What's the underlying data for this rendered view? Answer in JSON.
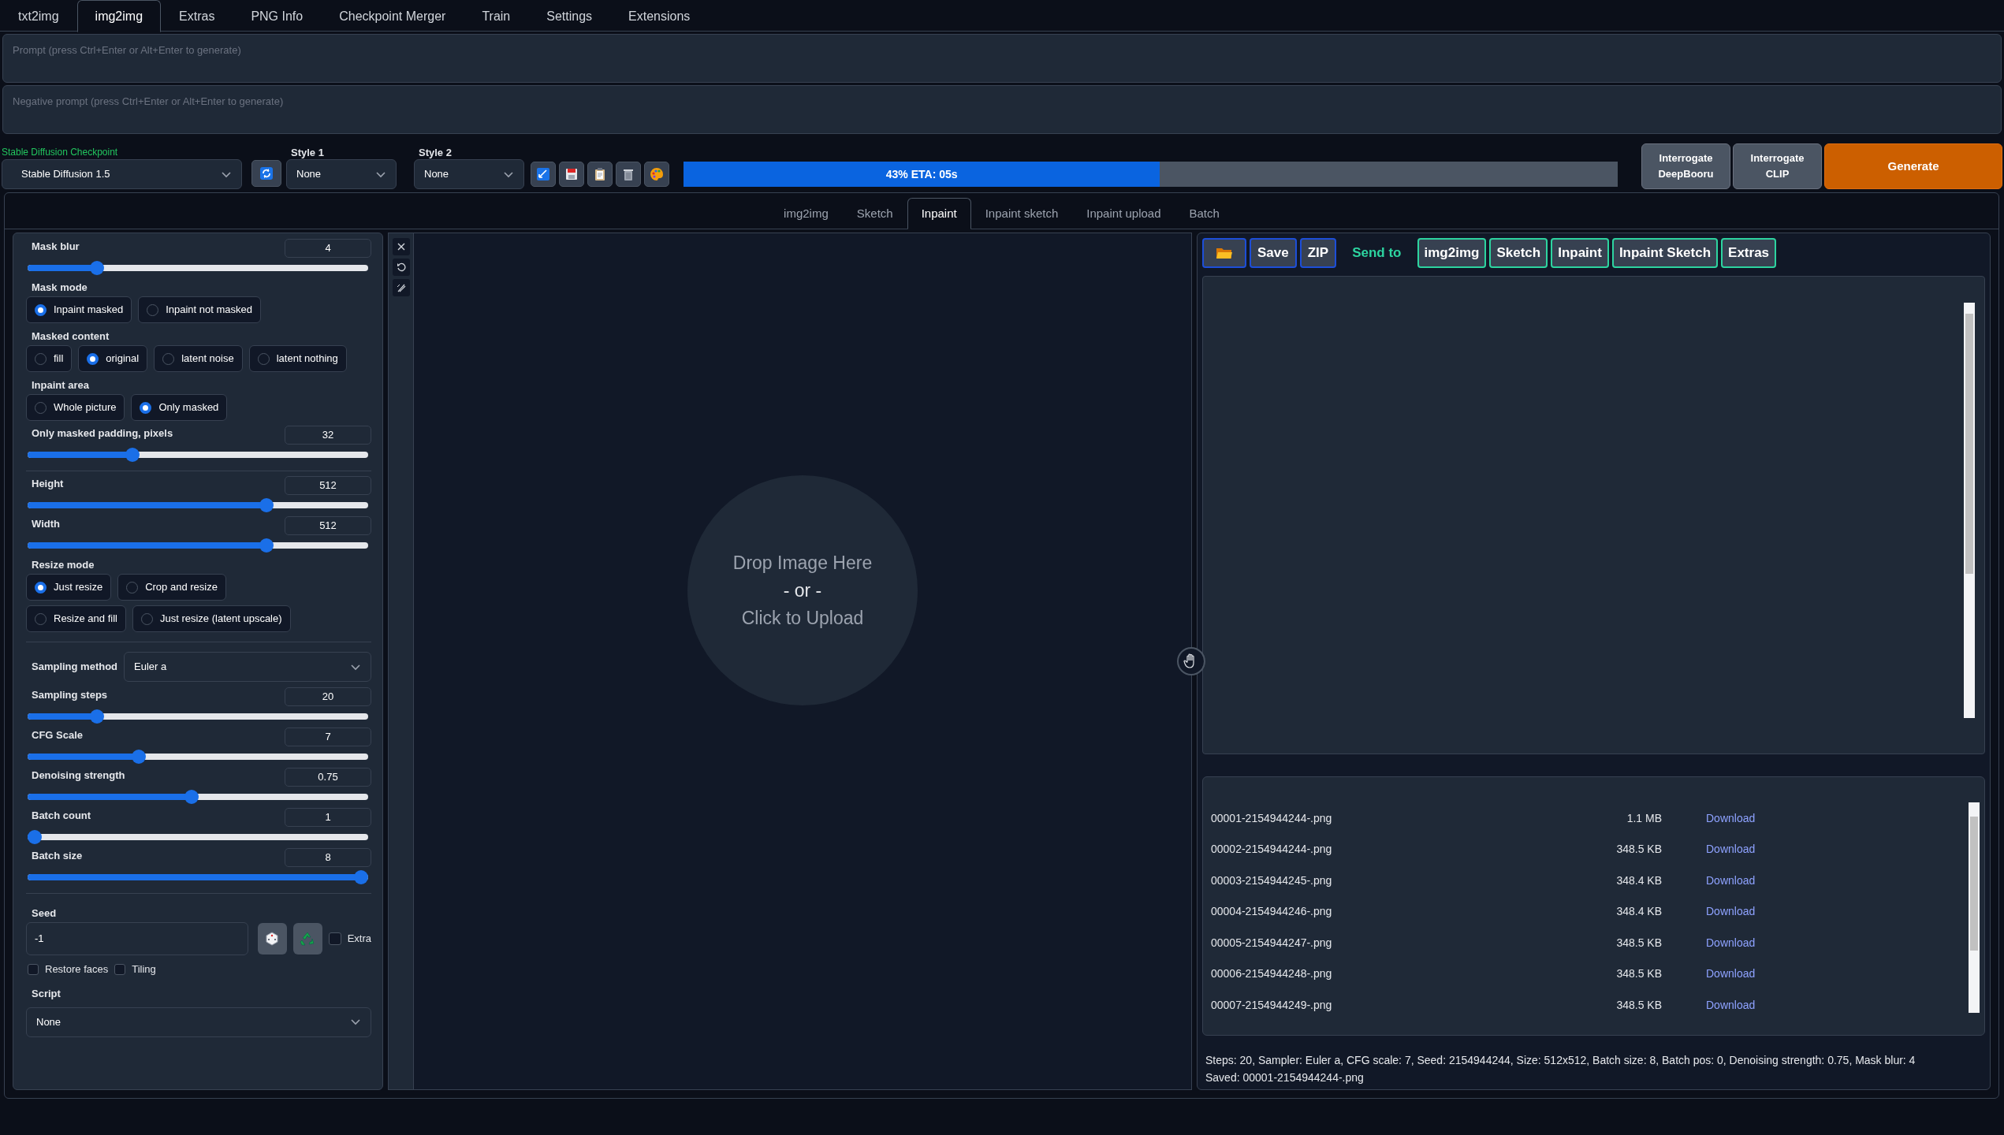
{
  "main_tabs": [
    {
      "label": "txt2img",
      "selected": false
    },
    {
      "label": "img2img",
      "selected": true
    },
    {
      "label": "Extras",
      "selected": false
    },
    {
      "label": "PNG Info",
      "selected": false
    },
    {
      "label": "Checkpoint Merger",
      "selected": false
    },
    {
      "label": "Train",
      "selected": false
    },
    {
      "label": "Settings",
      "selected": false
    },
    {
      "label": "Extensions",
      "selected": false
    }
  ],
  "prompt": {
    "placeholder": "Prompt (press Ctrl+Enter or Alt+Enter to generate)"
  },
  "negative_prompt": {
    "placeholder": "Negative prompt (press Ctrl+Enter or Alt+Enter to generate)"
  },
  "checkpoint": {
    "label": "Stable Diffusion Checkpoint",
    "value": "Stable Diffusion 1.5"
  },
  "styles": [
    {
      "label": "Style 1",
      "value": "None"
    },
    {
      "label": "Style 2",
      "value": "None"
    }
  ],
  "progress": {
    "level": 0.51,
    "text": "43% ETA: 05s"
  },
  "interrogate_buttons": [
    {
      "line1": "Interrogate",
      "line2": "DeepBooru"
    },
    {
      "line1": "Interrogate",
      "line2": "CLIP"
    }
  ],
  "generate_button": "Generate",
  "sub_tabs": [
    {
      "label": "img2img",
      "selected": false
    },
    {
      "label": "Sketch",
      "selected": false
    },
    {
      "label": "Inpaint",
      "selected": true
    },
    {
      "label": "Inpaint sketch",
      "selected": false
    },
    {
      "label": "Inpaint upload",
      "selected": false
    },
    {
      "label": "Batch",
      "selected": false
    }
  ],
  "settings_groups": [
    [
      {
        "kind": "slider",
        "label": "Mask blur",
        "value": "4",
        "level": 0.19
      },
      {
        "kind": "radio",
        "label": "Mask mode",
        "rows": [
          [
            {
              "label": "Inpaint masked",
              "selected": true
            },
            {
              "label": "Inpaint not masked",
              "selected": false
            }
          ]
        ]
      },
      {
        "kind": "radio",
        "label": "Masked content",
        "rows": [
          [
            {
              "label": "fill",
              "selected": false
            },
            {
              "label": "original",
              "selected": true
            },
            {
              "label": "latent noise",
              "selected": false
            },
            {
              "label": "latent nothing",
              "selected": false
            }
          ]
        ]
      },
      {
        "kind": "radio",
        "label": "Inpaint area",
        "rows": [
          [
            {
              "label": "Whole picture",
              "selected": false
            },
            {
              "label": "Only masked",
              "selected": true
            }
          ]
        ]
      },
      {
        "kind": "slider",
        "label": "Only masked padding, pixels",
        "value": "32",
        "level": 0.3
      }
    ],
    [
      {
        "kind": "slider",
        "label": "Height",
        "value": "512",
        "level": 0.71
      },
      {
        "kind": "slider",
        "label": "Width",
        "value": "512",
        "level": 0.71
      },
      {
        "kind": "radio",
        "label": "Resize mode",
        "rows": [
          [
            {
              "label": "Just resize",
              "selected": true
            },
            {
              "label": "Crop and resize",
              "selected": false
            }
          ],
          [
            {
              "label": "Resize and fill",
              "selected": false
            },
            {
              "label": "Just resize (latent upscale)",
              "selected": false
            }
          ]
        ]
      }
    ],
    [
      {
        "kind": "select_inline",
        "label": "Sampling method",
        "value": "Euler a"
      },
      {
        "kind": "slider",
        "label": "Sampling steps",
        "value": "20",
        "level": 0.19
      },
      {
        "kind": "slider",
        "label": "CFG Scale",
        "value": "7",
        "level": 0.32
      },
      {
        "kind": "slider",
        "label": "Denoising strength",
        "value": "0.75",
        "level": 0.48
      },
      {
        "kind": "slider",
        "label": "Batch count",
        "value": "1",
        "level": 0.0
      },
      {
        "kind": "slider",
        "label": "Batch size",
        "value": "8",
        "level": 1.0
      }
    ],
    [
      {
        "kind": "seed",
        "label": "Seed",
        "value": "-1",
        "extra": {
          "label": "Extra",
          "checked": false
        }
      },
      {
        "kind": "checks",
        "items": [
          {
            "label": "Restore faces",
            "checked": false
          },
          {
            "label": "Tiling",
            "checked": false
          }
        ]
      },
      {
        "kind": "select",
        "label": "Script",
        "value": "None"
      }
    ]
  ],
  "dropzone": {
    "line1": "Drop Image Here",
    "line2": "- or -",
    "line3": "Click to Upload"
  },
  "output_toolbar": {
    "buttons": [
      "Save",
      "ZIP"
    ],
    "send_label": "Send to",
    "send_buttons": [
      "img2img",
      "Sketch",
      "Inpaint",
      "Inpaint Sketch",
      "Extras"
    ]
  },
  "files": [
    {
      "name": "00001-2154944244-.png",
      "size": "1.1 MB",
      "link": "Download"
    },
    {
      "name": "00002-2154944244-.png",
      "size": "348.5 KB",
      "link": "Download"
    },
    {
      "name": "00003-2154944245-.png",
      "size": "348.4 KB",
      "link": "Download"
    },
    {
      "name": "00004-2154944246-.png",
      "size": "348.4 KB",
      "link": "Download"
    },
    {
      "name": "00005-2154944247-.png",
      "size": "348.5 KB",
      "link": "Download"
    },
    {
      "name": "00006-2154944248-.png",
      "size": "348.5 KB",
      "link": "Download"
    },
    {
      "name": "00007-2154944249-.png",
      "size": "348.5 KB",
      "link": "Download"
    }
  ],
  "info": [
    "Steps: 20, Sampler: Euler a, CFG scale: 7, Seed: 2154944244, Size: 512x512, Batch size: 8, Batch pos: 0, Denoising strength: 0.75, Mask blur: 4",
    "Saved: 00001-2154944244-.png"
  ]
}
